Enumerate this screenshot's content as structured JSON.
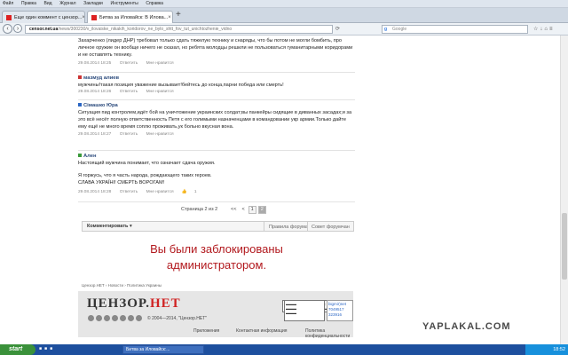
{
  "menu": [
    "Файл",
    "Правка",
    "Вид",
    "Журнал",
    "Закладки",
    "Инструменты",
    "Справка"
  ],
  "tabs": [
    {
      "title": "Еще один коммент с цензор..."
    },
    {
      "title": "Битва за Иловайск: В Илова..."
    }
  ],
  "address": {
    "domain": "censor.net.ua",
    "path": "/news/300230/v_ilovaiske_nikakih_koridorov_ne_bylo_shtt_fov_tut_unichtozhenie_vidno"
  },
  "search": {
    "placeholder": "Google"
  },
  "comments": [
    {
      "author": "",
      "text": "Захарченко (лидер ДНР) требовал только сдать тяжелую технику и снаряды, что бы потом не могли бомбить, про личное оружие он вообще ничего не сказал, но ребята молодцы решили не пользоваться гуманитарными коридорами и не оставлять технику.",
      "date": "29.08.2014 18:25",
      "reply": "Ответить",
      "like": "Мне нравится"
    },
    {
      "author": "мазмуд алиев",
      "text": "мужчины!такая позиция уважение вызывает!бейтесь до конца,парни победа или смерть!",
      "date": "29.08.2014 18:26",
      "reply": "Ответить",
      "like": "Мне нравится"
    },
    {
      "author": "Сімашко Юра",
      "text": "Ситуация пид контролем,идёт бой на уничтожение украинских солдат;вы панкейры сидящие в диванных засадах;и за это всё несёт полную ответственность Петя с его голимыми назначенцами в командовании укр армии.Только дайте ему ещё не много время соплю проживать,ук больно вкусная вона.",
      "date": "29.08.2014 18:27",
      "reply": "Ответить",
      "like": "Мне нравится"
    },
    {
      "author": "Ален",
      "text": "Настоящий мужчина понимает, что означает сдача оружия.",
      "text2": "Я горжусь, что я часть народа, рождающего таких героев.",
      "text3": "СЛАВА УКРАЇНІ! СМЕРТЬ ВОРОГАМ!",
      "date": "29.08.2014 18:28",
      "reply": "Ответить",
      "like": "Мне нравится",
      "likes": "1"
    }
  ],
  "pager": {
    "label": "Страница 2 из 2",
    "prev": "<<",
    "prev1": "<",
    "page1": "1",
    "page2": "2"
  },
  "comment_bar": {
    "button": "Комментировать",
    "rules": "Правила форума",
    "council": "Совет форумчан"
  },
  "blocked": {
    "line1": "Вы были заблокированы",
    "line2": "администратором."
  },
  "breadcrumbs": "Цензор.НЕТ › Новости › Политика Украины",
  "footer": {
    "logo_main": "ЦЕНЗОР.",
    "logo_net": "НЕТ",
    "copyright": "© 2004—2014, \"Цензор.НЕТ\"",
    "links": [
      "Приложения",
      "Контактная информация",
      "Политика конфиденциальности"
    ],
    "badge_ua": "ua",
    "bigmir": "bigmir)net",
    "bigmir_n1": "7049517",
    "bigmir_n2": "323916"
  },
  "watermark": "YAPLAKAL.COM",
  "taskbar": {
    "start": "start",
    "task1": "Битва за Иловайск:...",
    "clock": "18:52"
  },
  "colors": {
    "blocked": "#b2191e",
    "author": "#2b4a7c",
    "taskbar": "#1d4f9e"
  }
}
